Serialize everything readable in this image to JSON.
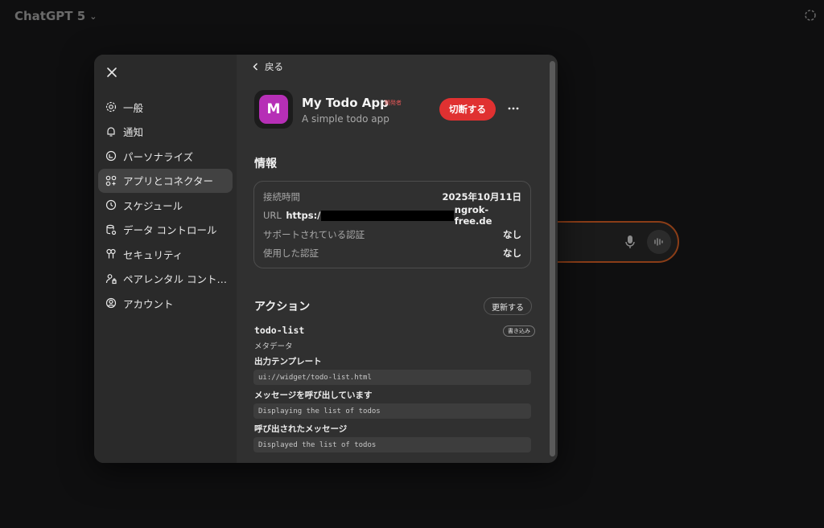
{
  "app": {
    "title": "ChatGPT 5"
  },
  "settings": {
    "nav": [
      {
        "label": "一般",
        "icon": "gear-icon"
      },
      {
        "label": "通知",
        "icon": "bell-icon"
      },
      {
        "label": "パーソナライズ",
        "icon": "personalize-icon"
      },
      {
        "label": "アプリとコネクター",
        "icon": "apps-icon",
        "active": true
      },
      {
        "label": "スケジュール",
        "icon": "clock-icon"
      },
      {
        "label": "データ コントロール",
        "icon": "database-icon"
      },
      {
        "label": "セキュリティ",
        "icon": "security-icon"
      },
      {
        "label": "ペアレンタル コント…",
        "icon": "parental-icon"
      },
      {
        "label": "アカウント",
        "icon": "account-icon"
      }
    ]
  },
  "detail": {
    "back_label": "戻る",
    "app_icon_letter": "M",
    "app_name": "My Todo App",
    "dev_badge": "開発者",
    "app_description": "A simple todo app",
    "disconnect_label": "切断する",
    "info_title": "情報",
    "info": {
      "connected_label": "接続時間",
      "connected_value": "2025年10月11日",
      "url_label": "URL",
      "url_prefix": "https:/",
      "url_suffix": "ngrok-free.de",
      "supported_auth_label": "サポートされている認証",
      "supported_auth_value": "なし",
      "used_auth_label": "使用した認証",
      "used_auth_value": "なし"
    },
    "actions_title": "アクション",
    "update_label": "更新する",
    "tool": {
      "name": "todo-list",
      "badge": "書き込み",
      "metadata_label": "メタデータ",
      "output_template_label": "出力テンプレート",
      "output_template_value": "ui://widget/todo-list.html",
      "invoking_label": "メッセージを呼び出しています",
      "invoking_value": "Displaying the list of todos",
      "invoked_label": "呼び出されたメッセージ",
      "invoked_value": "Displayed the list of todos"
    }
  },
  "colors": {
    "accent_red": "#e03131",
    "app_icon": "#b62fb6",
    "composer_border": "#8a3d17"
  }
}
